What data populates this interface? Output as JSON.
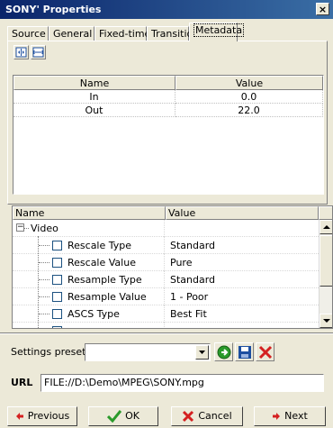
{
  "window": {
    "title": "SONY' Properties",
    "close_glyph": "×"
  },
  "tabs": [
    "Source",
    "General",
    "Fixed-time",
    "Transition",
    "Metadata"
  ],
  "active_tab": "Metadata",
  "top_grid": {
    "headers": [
      "Name",
      "Value"
    ],
    "rows": [
      {
        "name": "In",
        "value": "0.0"
      },
      {
        "name": "Out",
        "value": "22.0"
      }
    ]
  },
  "metadata_grid": {
    "headers": [
      "Name",
      "Value"
    ],
    "root": {
      "label": "Video",
      "expander": "−"
    },
    "rows": [
      {
        "name": "Rescale Type",
        "value": "Standard"
      },
      {
        "name": "Rescale Value",
        "value": "Pure"
      },
      {
        "name": "Resample Type",
        "value": "Standard"
      },
      {
        "name": "Resample Value",
        "value": "1 - Poor"
      },
      {
        "name": "ASCS Type",
        "value": "Best Fit"
      }
    ]
  },
  "settings_preset": {
    "label": "Settings preset",
    "value": ""
  },
  "url": {
    "label": "URL",
    "value": "FILE://D:\\Demo\\MPEG\\SONY.mpg"
  },
  "buttons": {
    "previous": "Previous",
    "ok": "OK",
    "cancel": "Cancel",
    "next": "Next"
  },
  "colors": {
    "title_start": "#0a246a",
    "title_end": "#3a6ea5",
    "face": "#ece9d8",
    "accent_red": "#d42020",
    "accent_green": "#2a9a2a"
  }
}
